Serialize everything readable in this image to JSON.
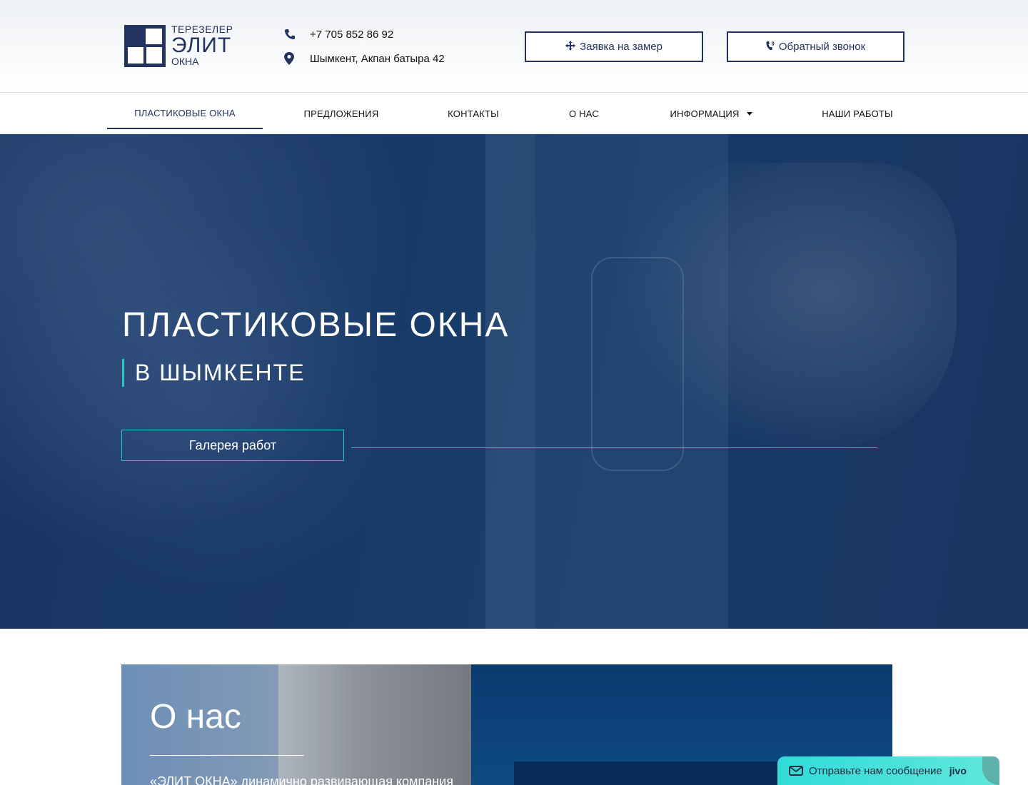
{
  "logo": {
    "line1": "ТЕРЕЗЕЛЕР",
    "line2": "ЭЛИТ",
    "line3": "ОКНА"
  },
  "header": {
    "phone": "+7 705 852 86 92",
    "address": "Шымкент, Акпан батыра 42",
    "measure_button": "Заявка на замер",
    "callback_button": "Обратный звонок"
  },
  "nav": {
    "items": [
      {
        "label": "ПЛАСТИКОВЫЕ ОКНА"
      },
      {
        "label": "ПРЕДЛОЖЕНИЯ"
      },
      {
        "label": "КОНТАКТЫ"
      },
      {
        "label": "О НАС"
      },
      {
        "label": "ИНФОРМАЦИЯ"
      },
      {
        "label": "НАШИ РАБОТЫ"
      }
    ]
  },
  "hero": {
    "title": "ПЛАСТИКОВЫЕ ОКНА",
    "subtitle": "В ШЫМКЕНТЕ",
    "gallery_button": "Галерея работ"
  },
  "about": {
    "title": "О нас",
    "text": "«ЭЛИТ ОКНА» динамично развивающая компания"
  },
  "chat": {
    "label": "Отправьте нам сообщение",
    "brand": "jivo"
  },
  "colors": {
    "brand": "#22335f",
    "accent": "#2ec4c4",
    "hero_bg": "#1c3e6e"
  }
}
